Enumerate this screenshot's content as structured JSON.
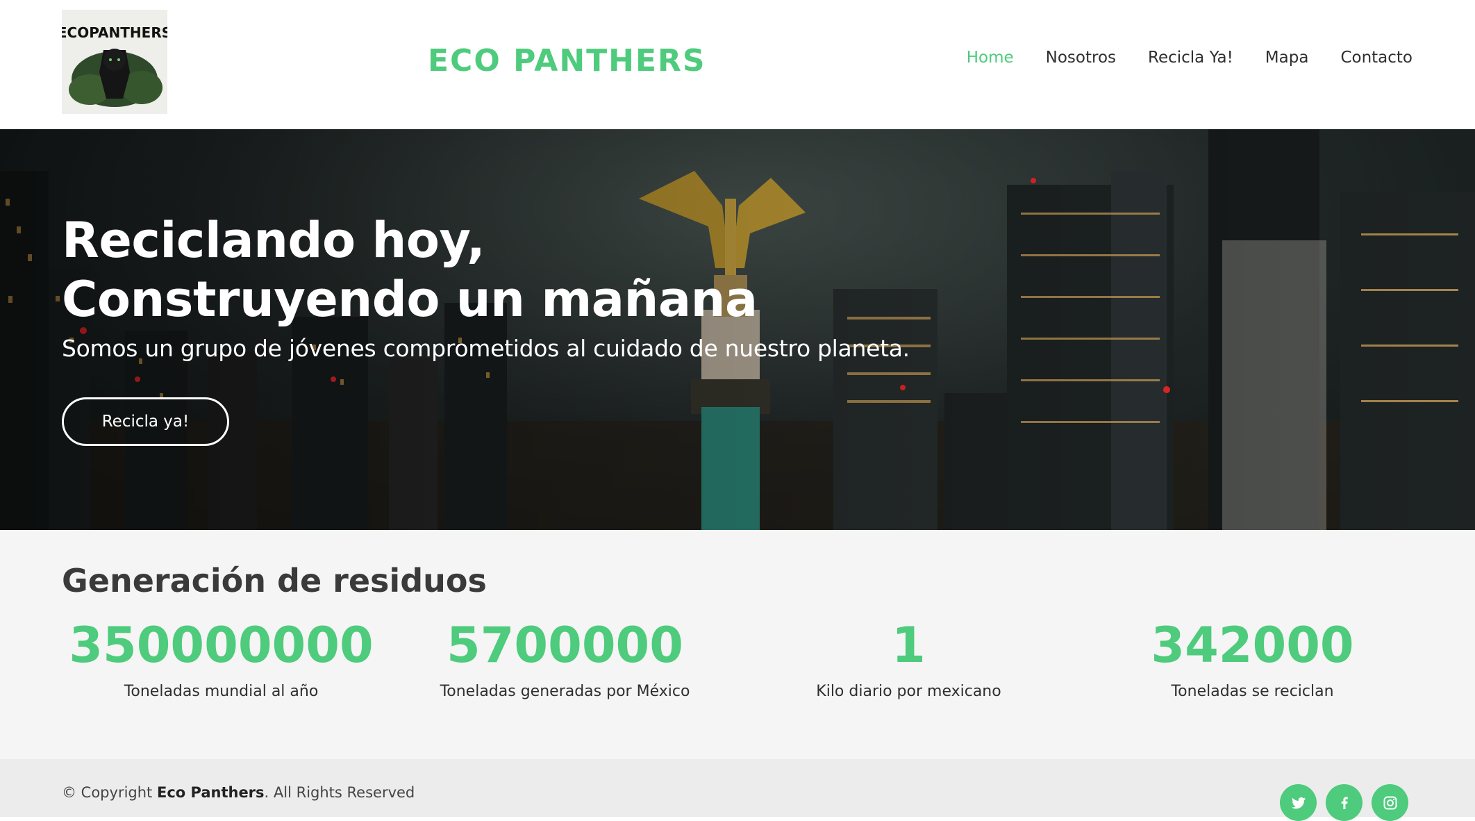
{
  "header": {
    "brand": "ECO PANTHERS",
    "logo_text": "ECOPANTHERS",
    "nav": [
      "Home",
      "Nosotros",
      "Recicla Ya!",
      "Mapa",
      "Contacto"
    ]
  },
  "hero": {
    "title_line1": "Reciclando hoy,",
    "title_line2": "Construyendo un mañana",
    "subtitle": "Somos un grupo de jóvenes comprometidos al cuidado de nuestro planeta.",
    "button": "Recicla ya!"
  },
  "stats": {
    "title": "Generación de residuos",
    "items": [
      {
        "value": "350000000",
        "label": "Toneladas mundial al año"
      },
      {
        "value": "5700000",
        "label": "Toneladas generadas por México"
      },
      {
        "value": "1",
        "label": "Kilo diario por mexicano"
      },
      {
        "value": "342000",
        "label": "Toneladas se reciclan"
      }
    ]
  },
  "footer": {
    "copyright_prefix": "© Copyright ",
    "copyright_brand": "Eco Panthers",
    "copyright_suffix": ". All Rights Reserved",
    "social": [
      "twitter-icon",
      "facebook-icon",
      "instagram-icon"
    ]
  },
  "colors": {
    "accent": "#4ecb7c",
    "text_dark": "#2f2f2f",
    "stats_bg": "#f5f5f5",
    "footer_bg": "#ececec"
  }
}
